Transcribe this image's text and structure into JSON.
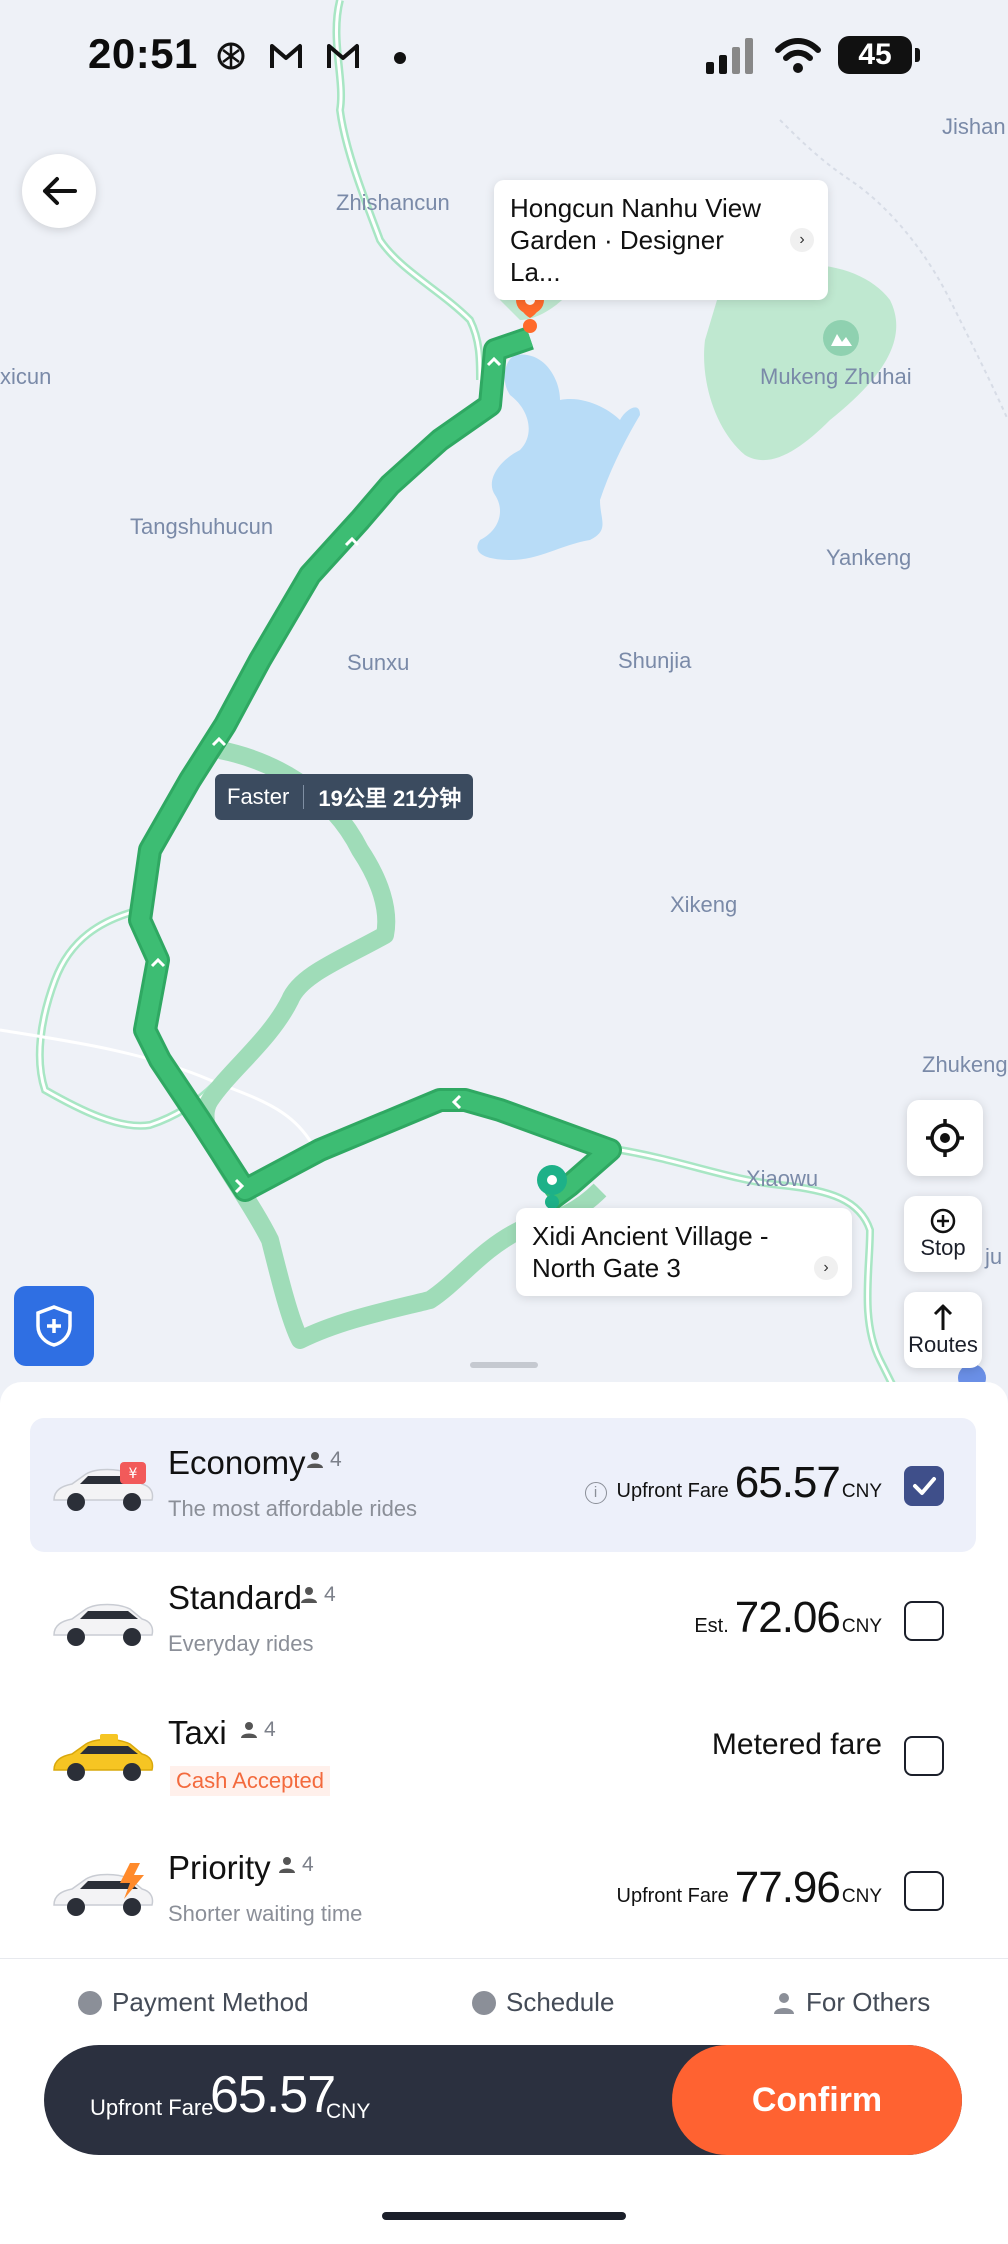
{
  "status_bar": {
    "time": "20:51",
    "battery": "45"
  },
  "map": {
    "place_labels": [
      "Zhishancun",
      "Jishan",
      "xicun",
      "Mukeng Zhuhai",
      "Tangshuhucun",
      "Yankeng",
      "Sunxu",
      "Shunjia",
      "Xikeng",
      "Zhukeng",
      "Xiaowu",
      "ju"
    ],
    "destination_callout": "Hongcun Nanhu View Garden · Designer La...",
    "origin_callout": "Xidi Ancient Village - North Gate 3",
    "route_tag": {
      "label": "Faster",
      "detail": "19公里 21分钟"
    },
    "controls": {
      "stop": "Stop",
      "routes": "Routes"
    },
    "colors": {
      "route_primary": "#3dbd73",
      "route_alt": "#9fdcb8",
      "water": "#b8dcf7",
      "park": "#bfe8d0",
      "origin_pin": "#1db188",
      "destination_pin": "#ff6a2b"
    }
  },
  "rides": [
    {
      "name": "Economy",
      "pax": "4",
      "subtitle": "The most affordable rides",
      "price_label": "Upfront Fare",
      "price": "65.57",
      "currency": "CNY",
      "selected": true
    },
    {
      "name": "Standard",
      "pax": "4",
      "subtitle": "Everyday rides",
      "price_label": "Est.",
      "price": "72.06",
      "currency": "CNY",
      "selected": false
    },
    {
      "name": "Taxi",
      "pax": "4",
      "subtitle": "Cash Accepted",
      "price_text": "Metered fare",
      "selected": false
    },
    {
      "name": "Priority",
      "pax": "4",
      "subtitle": "Shorter waiting time",
      "price_label": "Upfront Fare",
      "price": "77.96",
      "currency": "CNY",
      "selected": false
    }
  ],
  "options": {
    "payment": "Payment Method",
    "schedule": "Schedule",
    "for_others": "For Others"
  },
  "confirm": {
    "fare_label": "Upfront Fare",
    "fare": "65.57",
    "currency": "CNY",
    "button": "Confirm"
  }
}
